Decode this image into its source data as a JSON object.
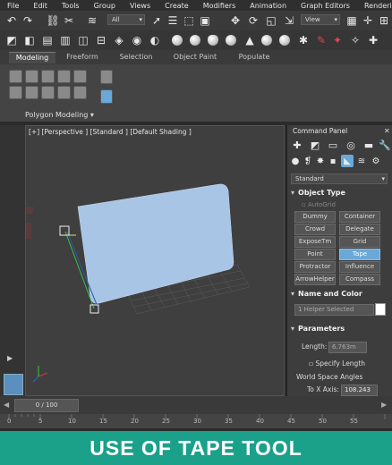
{
  "menu": [
    "File",
    "Edit",
    "Tools",
    "Group",
    "Views",
    "Create",
    "Modifiers",
    "Animation",
    "Graph Editors",
    "Rendering"
  ],
  "toolbar": {
    "selection_filter": "All",
    "view_dropdown": "View",
    "icons_row1": [
      "undo-icon",
      "redo-icon",
      "link-icon",
      "unlink-icon",
      "bind-icon",
      "select-icon",
      "select-region-icon",
      "move-icon",
      "rotate-icon",
      "scale-icon",
      "pin-icon"
    ],
    "icons_row2": [
      "snap-icon",
      "layer-icon",
      "scene-explorer-icon",
      "track-view-icon",
      "curve-editor-icon",
      "material-icon",
      "render-setup-icon",
      "render-icon"
    ]
  },
  "ribbon": {
    "tabs": [
      "Modeling",
      "Freeform",
      "Selection",
      "Object Paint",
      "Populate"
    ],
    "active_tab": "Modeling",
    "panel_label": "Polygon Modeling ▾"
  },
  "viewport": {
    "label": "[+] [Perspective ] [Standard ] [Default Shading ]"
  },
  "command_panel": {
    "title": "Command Panel",
    "category": "Standard",
    "object_type": {
      "header": "Object Type",
      "autogrid": "AutoGrid",
      "buttons": [
        "Dummy",
        "Container",
        "Crowd",
        "Delegate",
        "ExposeTm",
        "Grid",
        "Point",
        "Tape",
        "Protractor",
        "Influence",
        "ArrowHelper",
        "Compass"
      ],
      "active": "Tape"
    },
    "name_color": {
      "header": "Name and Color",
      "name_value": "1 Helper Selected",
      "swatch": "#ffffff"
    },
    "parameters": {
      "header": "Parameters",
      "length_label": "Length:",
      "length_value": "6.763m",
      "specify_length": "Specify Length",
      "world_angles": "World Space Angles",
      "to_x_label": "To X Axis:",
      "to_x_value": "108.243"
    }
  },
  "timeline": {
    "frame_display": "0 / 100",
    "ticks": [
      "0",
      "5",
      "10",
      "15",
      "20",
      "25",
      "30",
      "35",
      "40",
      "45",
      "50",
      "55"
    ]
  },
  "banner": {
    "text": "USE OF TAPE TOOL",
    "color": "#1ba08a"
  },
  "colors": {
    "active_button": "#6aa8d8",
    "plane": "#a9c5e6"
  }
}
